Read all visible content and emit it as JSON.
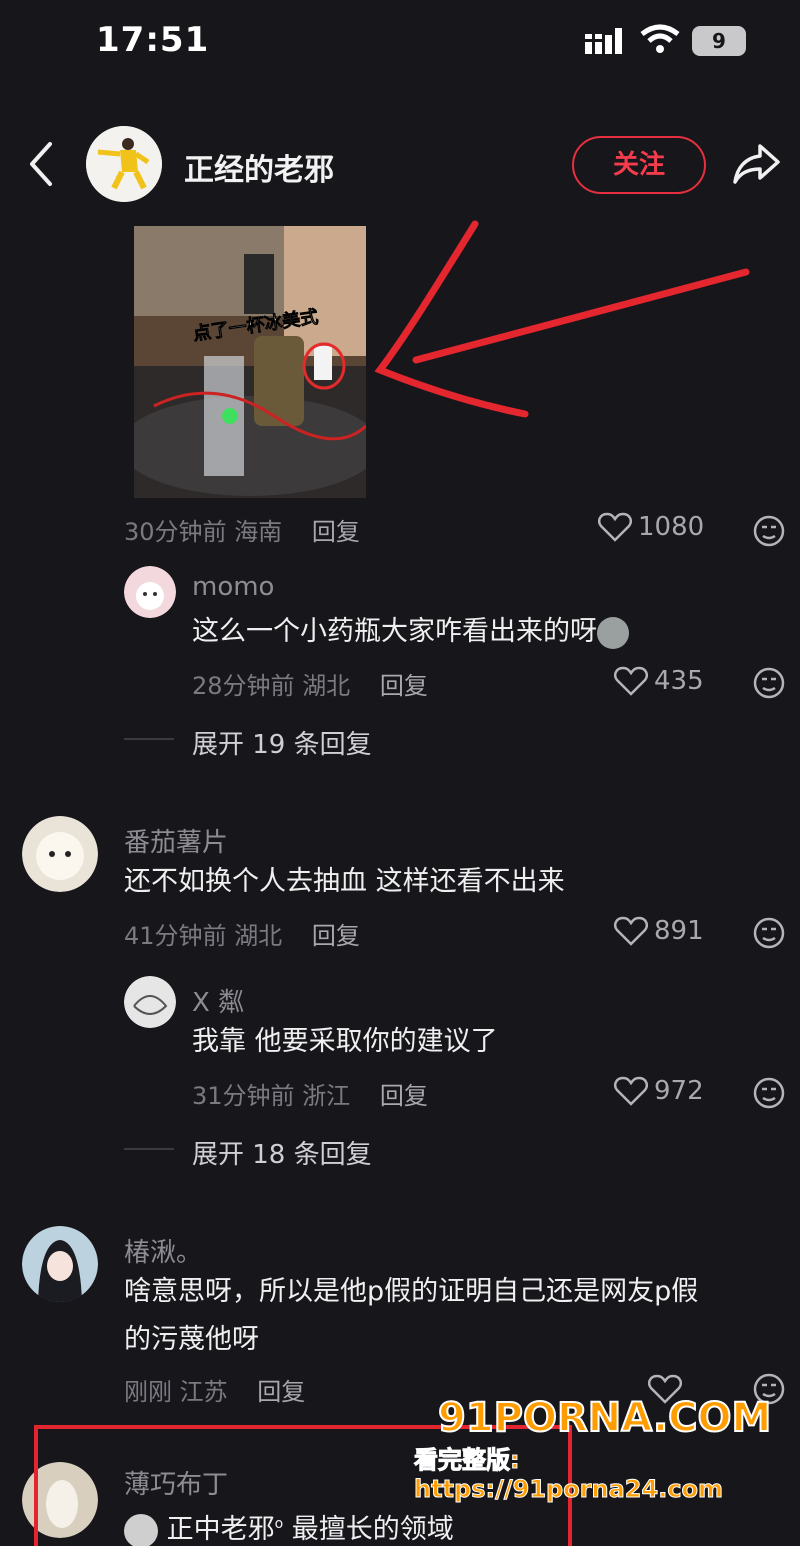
{
  "status_bar": {
    "time": "17:51",
    "battery": "9"
  },
  "header": {
    "username": "正经的老邪",
    "follow_label": "关注"
  },
  "post": {
    "image_caption": "点了一杯冰美式",
    "meta_time": "30分钟前",
    "meta_location": "海南",
    "reply_label": "回复",
    "likes": "1080"
  },
  "comments": [
    {
      "name": "momo",
      "text": "这么一个小药瓶大家咋看出来的呀",
      "time": "28分钟前",
      "location": "湖北",
      "reply_label": "回复",
      "likes": "435",
      "expand": "展开 19 条回复"
    },
    {
      "name": "番茄薯片",
      "text": "还不如换个人去抽血 这样还看不出来",
      "time": "41分钟前",
      "location": "湖北",
      "reply_label": "回复",
      "likes": "891"
    },
    {
      "name": "X 粼",
      "text": "我靠 他要采取你的建议了",
      "time": "31分钟前",
      "location": "浙江",
      "reply_label": "回复",
      "likes": "972",
      "expand": "展开 18 条回复"
    },
    {
      "name": "椿湫。",
      "text_line1": "啥意思呀，所以是他p假的证明自己还是网友p假",
      "text_line2": "的污蔑他呀",
      "time": "刚刚",
      "location": "江苏",
      "reply_label": "回复"
    },
    {
      "name": "薄巧布丁",
      "text": "正中老邪",
      "text_tail": "最擅长的领域"
    }
  ],
  "watermark": {
    "brand": "91PORNA.COM",
    "sub": "看完整版: https://91porna24.com"
  }
}
